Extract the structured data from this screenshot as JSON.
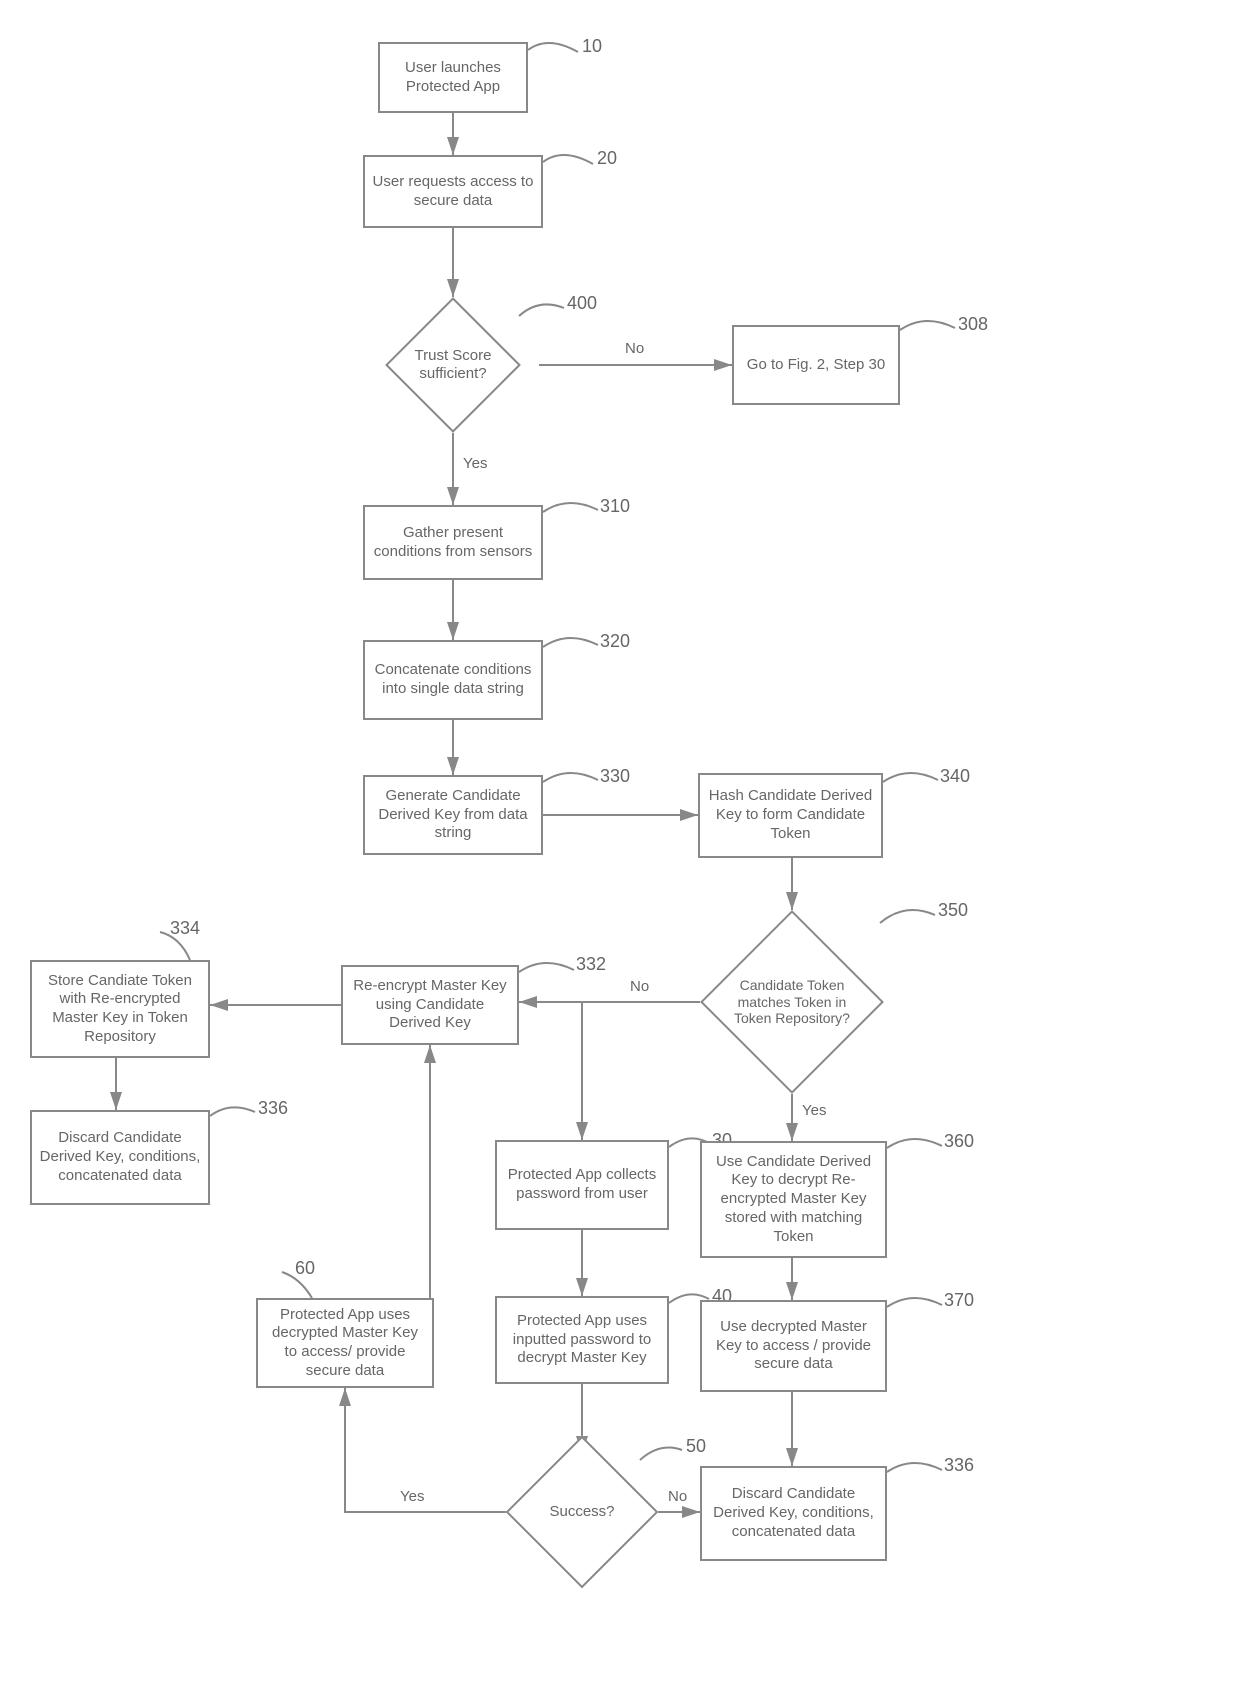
{
  "nodes": {
    "n10": {
      "label": "User launches Protected App",
      "num": "10"
    },
    "n20": {
      "label": "User requests access to secure data",
      "num": "20"
    },
    "n400": {
      "label": "Trust Score sufficient?",
      "num": "400"
    },
    "n308": {
      "label": "Go to Fig. 2, Step 30",
      "num": "308"
    },
    "n310": {
      "label": "Gather present conditions from sensors",
      "num": "310"
    },
    "n320": {
      "label": "Concatenate conditions into single data string",
      "num": "320"
    },
    "n330": {
      "label": "Generate Candidate Derived Key from data string",
      "num": "330"
    },
    "n340": {
      "label": "Hash Candidate Derived Key to form Candidate Token",
      "num": "340"
    },
    "n350": {
      "label": "Candidate Token matches Token in Token Repository?",
      "num": "350"
    },
    "n332": {
      "label": "Re-encrypt Master Key using Candidate Derived Key",
      "num": "332"
    },
    "n334": {
      "label": "Store Candiate Token with Re-encrypted Master Key in Token Repository",
      "num": "334"
    },
    "n336a": {
      "label": "Discard Candidate Derived Key, conditions, concatenated data",
      "num": "336"
    },
    "n30": {
      "label": "Protected App collects password from user",
      "num": "30"
    },
    "n40": {
      "label": "Protected App uses inputted password to decrypt Master Key",
      "num": "40"
    },
    "n50": {
      "label": "Success?",
      "num": "50"
    },
    "n60": {
      "label": "Protected App uses decrypted Master Key to access/ provide secure data",
      "num": "60"
    },
    "n360": {
      "label": "Use Candidate Derived Key to decrypt Re-encrypted Master Key stored with matching Token",
      "num": "360"
    },
    "n370": {
      "label": "Use decrypted Master Key to access / provide secure data",
      "num": "370"
    },
    "n336b": {
      "label": "Discard Candidate Derived Key, conditions, concatenated data",
      "num": "336"
    }
  },
  "edges": {
    "e400no": "No",
    "e400yes": "Yes",
    "e350no": "No",
    "e350yes": "Yes",
    "e50yes": "Yes",
    "e50no": "No"
  }
}
